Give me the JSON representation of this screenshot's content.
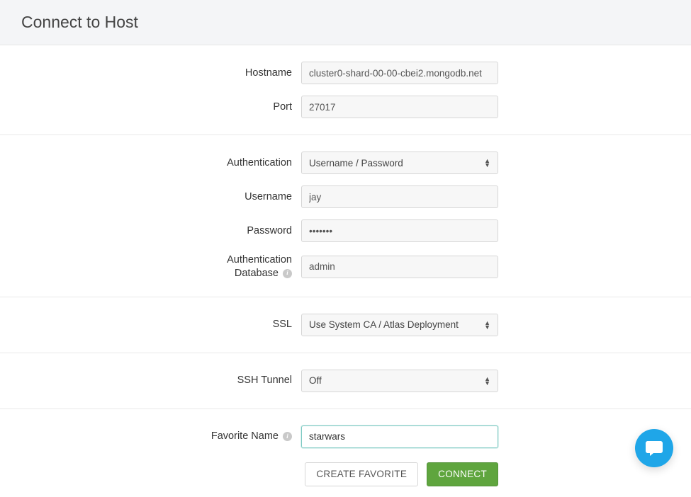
{
  "header": {
    "title": "Connect to Host"
  },
  "host": {
    "hostname_label": "Hostname",
    "hostname_value": "cluster0-shard-00-00-cbei2.mongodb.net",
    "port_label": "Port",
    "port_value": "27017"
  },
  "auth": {
    "auth_label": "Authentication",
    "auth_value": "Username / Password",
    "username_label": "Username",
    "username_value": "jay",
    "password_label": "Password",
    "password_value": "•••••••",
    "authdb_label_line1": "Authentication",
    "authdb_label_line2": "Database",
    "authdb_value": "admin"
  },
  "ssl": {
    "label": "SSL",
    "value": "Use System CA / Atlas Deployment"
  },
  "ssh": {
    "label": "SSH Tunnel",
    "value": "Off"
  },
  "favorite": {
    "label": "Favorite Name",
    "value": "starwars"
  },
  "buttons": {
    "create_favorite": "CREATE FAVORITE",
    "connect": "CONNECT"
  }
}
